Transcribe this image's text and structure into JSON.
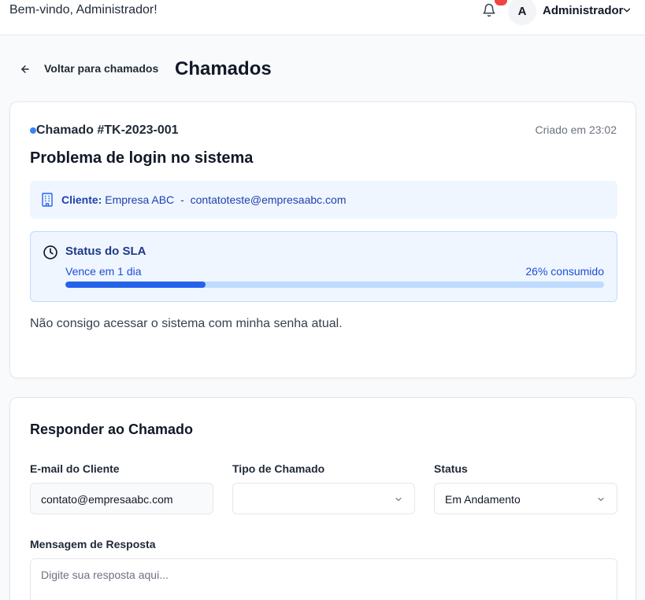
{
  "header": {
    "welcome": "Bem-vindo, Administrador!",
    "avatar_initial": "A",
    "user_name": "Administrador",
    "notification_icon": "bell-icon",
    "badge_color": "#ef4444"
  },
  "nav": {
    "back_label": "Voltar para chamados",
    "page_title": "Chamados"
  },
  "ticket": {
    "id_label": "Chamado #TK-2023-001",
    "created": "Criado em 23:02",
    "title": "Problema de login no sistema",
    "client_label": "Cliente:",
    "client_name": "Empresa ABC",
    "client_separator": "-",
    "client_email": "contatoteste@empresaabc.com",
    "sla": {
      "title": "Status do SLA",
      "due": "Vence em 1 dia",
      "consumed_label": "26% consumido",
      "consumed_percent": 26
    },
    "description": "Não consigo acessar o sistema com minha senha atual."
  },
  "reply": {
    "title": "Responder ao Chamado",
    "email_label": "E-mail do Cliente",
    "email_value": "contato@empresaabc.com",
    "type_label": "Tipo de Chamado",
    "type_value": "",
    "status_label": "Status",
    "status_value": "Em Andamento",
    "message_label": "Mensagem de Resposta",
    "message_placeholder": "Digite sua resposta aqui..."
  },
  "colors": {
    "accent": "#2563eb",
    "sla_bg": "#eff6ff",
    "status_dot": "#3b82f6"
  }
}
